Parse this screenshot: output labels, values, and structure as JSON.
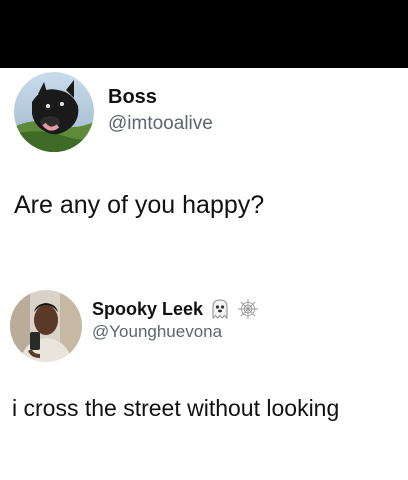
{
  "tweets": [
    {
      "display_name": "Boss",
      "handle": "@imtooalive",
      "text": "Are any of you happy?",
      "avatar": "dog-photo-avatar"
    },
    {
      "display_name": "Spooky Leek",
      "handle": "@Younghuevona",
      "text": "i cross the street without looking",
      "avatar": "person-selfie-avatar",
      "name_emojis": [
        "ghost-icon",
        "spider-web-icon"
      ]
    }
  ],
  "colors": {
    "top_bar": "#000000",
    "background": "#ffffff",
    "text": "#111111",
    "handle": "#5c6670"
  }
}
